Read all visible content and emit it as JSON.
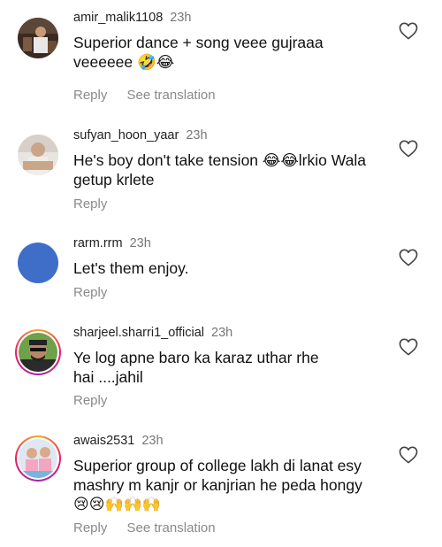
{
  "comments": [
    {
      "username": "amir_malik1108",
      "time": "23h",
      "line1": "Superior dance + song veee gujraaa",
      "line2": "veeeeee 🤣😂",
      "reply": "Reply",
      "see_translation": "See translation"
    },
    {
      "username": "sufyan_hoon_yaar",
      "time": "23h",
      "line1": "He's boy don't take tension 😂😂lrkio Wala",
      "line2": "getup krlete",
      "reply": "Reply"
    },
    {
      "username": "rarm.rrm",
      "time": "23h",
      "line1": "Let's them enjoy.",
      "reply": "Reply"
    },
    {
      "username": "sharjeel.sharri1_official",
      "time": "23h",
      "line1": "Ye log apne baro ka karaz uthar rhe",
      "line2": "hai ....jahil",
      "reply": "Reply"
    },
    {
      "username": "awais2531",
      "time": "23h",
      "line1": "Superior group of college lakh di lanat esy",
      "line2": "mashry m kanjr or kanjrian he peda hongy",
      "line3": "😢😢🙌🙌🙌",
      "reply": "Reply",
      "see_translation": "See translation"
    }
  ],
  "icons": {
    "like": "heart-outline-icon"
  },
  "colors": {
    "secondary_text": "#8a8a8a",
    "avatar_blue": "#3f6ec9"
  }
}
